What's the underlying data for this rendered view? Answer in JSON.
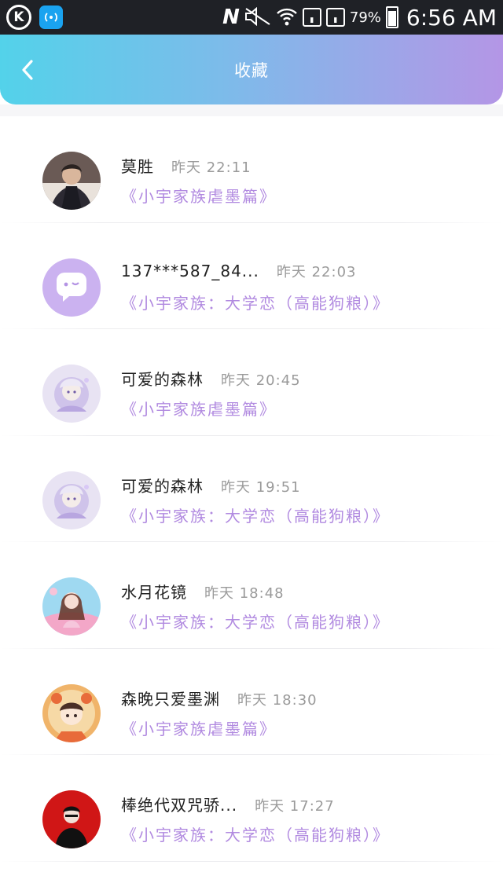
{
  "status_bar": {
    "k_icon": "K",
    "network_icon": "network-icon",
    "n_icon": "N",
    "battery_percent": "79%",
    "battery_level": 0.79,
    "time": "6:56 AM"
  },
  "header": {
    "back_icon": "chevron-left-icon",
    "title": "收藏"
  },
  "colors": {
    "header_start": "#53d2ea",
    "header_end": "#b496e6",
    "book_title": "#b18ae0",
    "time_text": "#9a9a9a"
  },
  "items": [
    {
      "name": "莫胜",
      "time": "昨天 22:11",
      "book": "《小宇家族虐墨篇》",
      "avatar": "avatar-anime-man"
    },
    {
      "name": "137***587_84...",
      "time": "昨天 22:03",
      "book": "《小宇家族：大学恋（高能狗粮）》",
      "avatar": "avatar-default-chat"
    },
    {
      "name": "可爱的森林",
      "time": "昨天 20:45",
      "book": "《小宇家族虐墨篇》",
      "avatar": "avatar-anime-girl-purple"
    },
    {
      "name": "可爱的森林",
      "time": "昨天 19:51",
      "book": "《小宇家族：大学恋（高能狗粮）》",
      "avatar": "avatar-anime-girl-purple"
    },
    {
      "name": "水月花镜",
      "time": "昨天 18:48",
      "book": "《小宇家族：大学恋（高能狗粮）》",
      "avatar": "avatar-anime-girl-pink"
    },
    {
      "name": "森晚只爱墨渊",
      "time": "昨天 18:30",
      "book": "《小宇家族虐墨篇》",
      "avatar": "avatar-chibi-orange"
    },
    {
      "name": "棒绝代双咒骄...",
      "time": "昨天 17:27",
      "book": "《小宇家族：大学恋（高能狗粮）》",
      "avatar": "avatar-red-figure"
    }
  ]
}
